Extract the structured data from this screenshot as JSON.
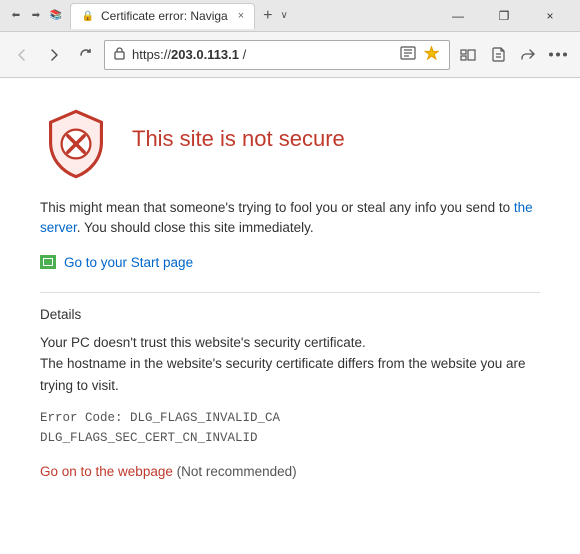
{
  "titlebar": {
    "tab_title": "Certificate error: Naviga",
    "tab_close": "×",
    "new_tab": "+",
    "tab_dropdown": "∨",
    "win_minimize": "—",
    "win_restore": "❐",
    "win_close": "×"
  },
  "addressbar": {
    "back": "‹",
    "forward": "›",
    "refresh": "↻",
    "url_prefix": "https://",
    "url_bold": "203.0.113.1",
    "url_suffix": " /",
    "lock_icon": "⊙",
    "read_mode": "📖",
    "favorites": "☆",
    "toolbar_icons": [
      "✦",
      "✏",
      "↗",
      "•••"
    ]
  },
  "error": {
    "title": "This site is not secure",
    "body": "This might mean that someone's trying to fool you or steal any info you send to the server. You should close this site immediately.",
    "start_page_label": "Go to your Start page",
    "details_heading": "Details",
    "details_text_line1": "Your PC doesn't trust this website's security certificate.",
    "details_text_line2": "The hostname in the website's security certificate differs from the website you are trying to visit.",
    "error_code_line1": "Error Code:  DLG_FLAGS_INVALID_CA",
    "error_code_line2": "DLG_FLAGS_SEC_CERT_CN_INVALID",
    "go_on_text": "Go on to the webpage",
    "go_on_note": "(Not recommended)"
  }
}
